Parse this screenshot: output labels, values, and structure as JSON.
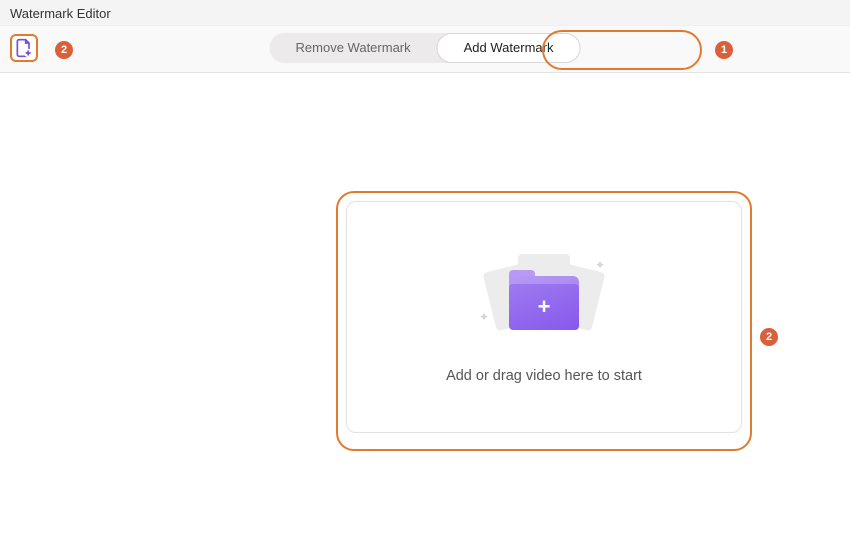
{
  "window": {
    "title": "Watermark Editor"
  },
  "toolbar": {
    "add_file_tooltip": "Add file"
  },
  "tabs": {
    "remove": "Remove Watermark",
    "add": "Add Watermark"
  },
  "dropzone": {
    "prompt": "Add or drag video here to start"
  },
  "callouts": {
    "one": "1",
    "two_a": "2",
    "two_b": "2"
  }
}
